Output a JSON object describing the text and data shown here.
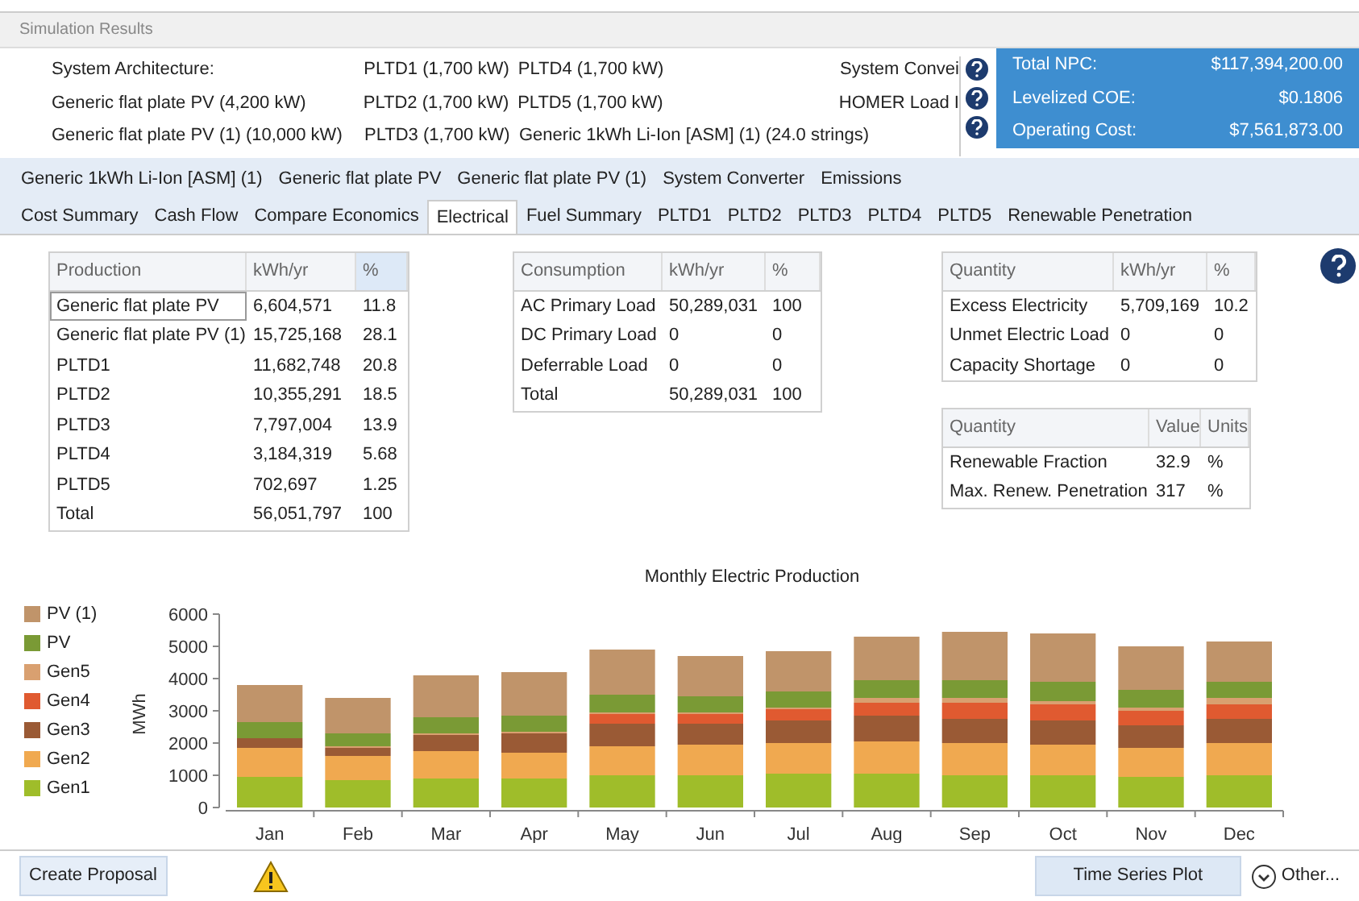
{
  "window": {
    "title": "Simulation Results"
  },
  "architecture": [
    [
      "System Architecture:",
      "PLTD1 (1,700 kW)",
      "PLTD4 (1,700 kW)",
      "System Convei"
    ],
    [
      "Generic flat plate PV (4,200 kW)",
      "PLTD2 (1,700 kW)",
      "PLTD5 (1,700 kW)",
      "HOMER Load I"
    ],
    [
      "Generic flat plate PV (1) (10,000 kW)",
      "PLTD3 (1,700 kW)",
      "Generic 1kWh Li-Ion [ASM] (1) (24.0 strings)"
    ]
  ],
  "metrics": [
    {
      "label": "Total NPC:",
      "value": "$117,394,200.00"
    },
    {
      "label": "Levelized COE:",
      "value": "$0.1806"
    },
    {
      "label": "Operating Cost:",
      "value": "$7,561,873.00"
    }
  ],
  "tab_rows": [
    [
      {
        "label": "Generic 1kWh Li-Ion [ASM] (1)",
        "selected": false
      },
      {
        "label": "Generic flat plate PV",
        "selected": false
      },
      {
        "label": "Generic flat plate PV (1)",
        "selected": false
      },
      {
        "label": "System Converter",
        "selected": false
      },
      {
        "label": "Emissions",
        "selected": false
      }
    ],
    [
      {
        "label": "Cost Summary",
        "selected": false
      },
      {
        "label": "Cash Flow",
        "selected": false
      },
      {
        "label": "Compare Economics",
        "selected": false
      },
      {
        "label": "Electrical",
        "selected": true
      },
      {
        "label": "Fuel Summary",
        "selected": false
      },
      {
        "label": "PLTD1",
        "selected": false
      },
      {
        "label": "PLTD2",
        "selected": false
      },
      {
        "label": "PLTD3",
        "selected": false
      },
      {
        "label": "PLTD4",
        "selected": false
      },
      {
        "label": "PLTD5",
        "selected": false
      },
      {
        "label": "Renewable Penetration",
        "selected": false
      }
    ]
  ],
  "production": {
    "columns": [
      "Production",
      "kWh/yr",
      "%"
    ],
    "rows": [
      {
        "cells": [
          "Generic flat plate PV",
          "6,604,571",
          "11.8"
        ],
        "selected": true
      },
      {
        "cells": [
          "Generic flat plate PV (1)",
          "15,725,168",
          "28.1"
        ],
        "selected": false
      },
      {
        "cells": [
          "PLTD1",
          "11,682,748",
          "20.8"
        ],
        "selected": false
      },
      {
        "cells": [
          "PLTD2",
          "10,355,291",
          "18.5"
        ],
        "selected": false
      },
      {
        "cells": [
          "PLTD3",
          "7,797,004",
          "13.9"
        ],
        "selected": false
      },
      {
        "cells": [
          "PLTD4",
          "3,184,319",
          "5.68"
        ],
        "selected": false
      },
      {
        "cells": [
          "PLTD5",
          "702,697",
          "1.25"
        ],
        "selected": false
      },
      {
        "cells": [
          "Total",
          "56,051,797",
          "100"
        ],
        "selected": false
      }
    ]
  },
  "consumption": {
    "columns": [
      "Consumption",
      "kWh/yr",
      "%"
    ],
    "rows": [
      [
        "AC Primary Load",
        "50,289,031",
        "100"
      ],
      [
        "DC Primary Load",
        "0",
        "0"
      ],
      [
        "Deferrable Load",
        "0",
        "0"
      ],
      [
        "Total",
        "50,289,031",
        "100"
      ]
    ]
  },
  "quantity": {
    "columns": [
      "Quantity",
      "kWh/yr",
      "%"
    ],
    "rows": [
      [
        "Excess Electricity",
        "5,709,169",
        "10.2"
      ],
      [
        "Unmet Electric Load",
        "0",
        "0"
      ],
      [
        "Capacity Shortage",
        "0",
        "0"
      ]
    ]
  },
  "renewables": {
    "columns": [
      "Quantity",
      "Value",
      "Units"
    ],
    "rows": [
      [
        "Renewable Fraction",
        "32.9",
        "%"
      ],
      [
        "Max. Renew. Penetration",
        "317",
        "%"
      ]
    ]
  },
  "chart": {
    "chart_data": {
      "type": "bar",
      "title": "Monthly Electric Production",
      "ylabel": "MWh",
      "stacked": true,
      "legend": true,
      "categories": [
        "Jan",
        "Feb",
        "Mar",
        "Apr",
        "May",
        "Jun",
        "Jul",
        "Aug",
        "Sep",
        "Oct",
        "Nov",
        "Dec"
      ],
      "ylim": [
        0,
        6000
      ],
      "yticks": [
        0,
        1000,
        2000,
        3000,
        4000,
        5000,
        6000
      ],
      "series": [
        {
          "name": "Gen1",
          "color": "#9fbd2a",
          "values": [
            950,
            850,
            900,
            900,
            1000,
            1000,
            1050,
            1050,
            1000,
            1000,
            950,
            1000
          ]
        },
        {
          "name": "Gen2",
          "color": "#f0a950",
          "values": [
            900,
            750,
            850,
            800,
            900,
            950,
            950,
            1000,
            1000,
            950,
            900,
            1000
          ]
        },
        {
          "name": "Gen3",
          "color": "#9a5a35",
          "values": [
            300,
            250,
            500,
            600,
            700,
            650,
            700,
            800,
            750,
            750,
            700,
            750
          ]
        },
        {
          "name": "Gen4",
          "color": "#e05a30",
          "values": [
            0,
            0,
            0,
            0,
            300,
            300,
            350,
            400,
            500,
            500,
            450,
            450
          ]
        },
        {
          "name": "Gen5",
          "color": "#d9a070",
          "values": [
            0,
            50,
            50,
            50,
            50,
            50,
            50,
            150,
            150,
            100,
            100,
            200
          ]
        },
        {
          "name": "PV",
          "color": "#7a9a35",
          "values": [
            500,
            400,
            500,
            500,
            550,
            500,
            500,
            550,
            550,
            600,
            550,
            500
          ]
        },
        {
          "name": "PV (1)",
          "color": "#c0946a",
          "values": [
            1150,
            1100,
            1300,
            1350,
            1400,
            1250,
            1250,
            1350,
            1500,
            1500,
            1350,
            1250
          ]
        }
      ]
    }
  },
  "footer": {
    "proposal_button": "Create Proposal",
    "plot_button": "Time Series Plot",
    "other_button": "Other..."
  }
}
